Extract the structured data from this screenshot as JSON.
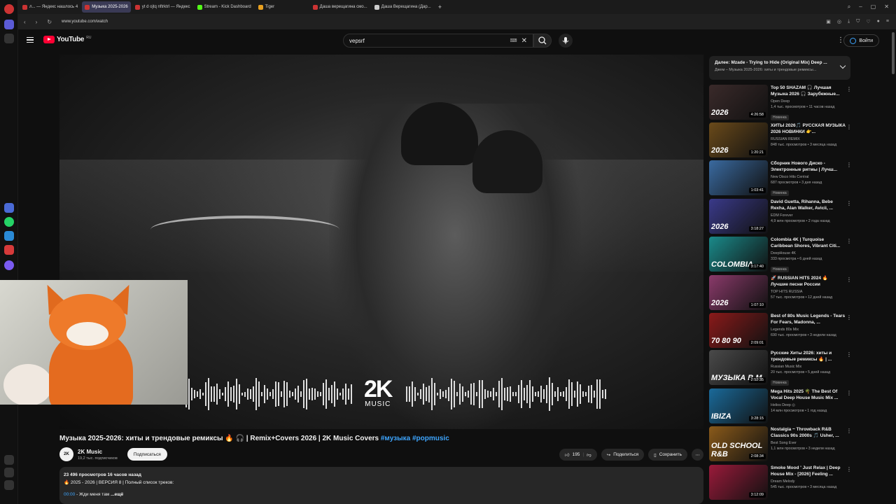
{
  "browser": {
    "tabs": [
      {
        "label": "л... — Яндекс нашлось 4"
      },
      {
        "label": "Музыка 2025-2026",
        "active": true
      },
      {
        "label": "yt d ojtq nftrktrl — Яндекс"
      },
      {
        "label": "Stream - Kick Dashboard"
      },
      {
        "label": "Tiger"
      },
      {
        "label": "Даша верещагина смо..."
      },
      {
        "label": "Даша Верещагина (Дар..."
      }
    ],
    "url": "www.youtube.com/watch"
  },
  "header": {
    "logo_text": "YouTube",
    "logo_region": "RU",
    "search_value": "vepsrf",
    "login_label": "Войти"
  },
  "video": {
    "title_main": "Музыка 2025-2026: хиты и трендовые ремиксы 🔥 🎧 | Remix+Covers 2026 | 2K Music Covers",
    "title_tags": "#музыка #popmusic",
    "logo_big": "2K",
    "logo_small": "MUSIC"
  },
  "channel": {
    "avatar_text": "2K",
    "name": "2K Music",
    "subscribers": "19,2 тыс. подписчиков",
    "subscribe_label": "Подписаться"
  },
  "actions": {
    "likes": "195",
    "share_label": "Поделиться",
    "save_label": "Сохранить"
  },
  "description": {
    "stats": "23 496 просмотров  16 часов назад",
    "line1": "🔥 2025 - 2026 | ВЕРСИЯ 8 | Полный список треков:",
    "timestamp": "00:00",
    "line2": " - Жди меня там",
    "more_label": "...ещё"
  },
  "upnext": {
    "title": "Далее: Mzade - Trying to Hide (Original Mix) Deep ...",
    "subtitle": "Джем – Музыка 2025-2026: хиты и трендовые ремиксы..."
  },
  "recommendations": [
    {
      "title": "Top 50 SHAZAM 🎧 Лучшая Музыка 2026 🎧 Зарубежные...",
      "channel": "Open Deep",
      "meta": "1,4 тыс. просмотров • 11 часов назад",
      "badge": "Новинка",
      "duration": "4:26:58",
      "thumb_text": "2026",
      "color": "#3a2a2a"
    },
    {
      "title": "ХИТЫ 2026🎵 РУССКАЯ МУЗЫКА 2026 НОВИНКИ 👉...",
      "channel": "RUSSIAN REMIX",
      "meta": "848 тыс. просмотров • 3 месяца назад",
      "badge": "",
      "duration": "1:20:21",
      "thumb_text": "2026",
      "color": "#6a4a1a"
    },
    {
      "title": "Сборник Нового Диско - Электронные ритмы | Лучш...",
      "channel": "New Disco Hits Central",
      "meta": "687 просмотров • 3 дня назад",
      "badge": "Новинка",
      "duration": "1:03:41",
      "thumb_text": "",
      "color": "#3a6aa0"
    },
    {
      "title": "David Guetta, Rihanna, Bebe Rexha, Alan Walker, Avicii, ...",
      "channel": "EDM Forever",
      "meta": "4,9 млн просмотров • 2 года назад",
      "badge": "",
      "duration": "3:18:27",
      "thumb_text": "2026",
      "color": "#3a3a8a"
    },
    {
      "title": "Colombia 4K | Turquoise Caribbean Shores, Vibrant Citi...",
      "channel": "DeepHouse 4K",
      "meta": "333 просмотра • 6 дней назад",
      "badge": "Новинка",
      "duration": "3:17:40",
      "thumb_text": "COLOMBIA",
      "color": "#1a8a8a"
    },
    {
      "title": "🚀 RUSSIAN HITS 2024 🔥 Лучшие песни России",
      "channel": "TOP HITS RUSSIA",
      "meta": "57 тыс. просмотров • 12 дней назад",
      "badge": "",
      "duration": "1:07:10",
      "thumb_text": "2026",
      "color": "#8a3a6a"
    },
    {
      "title": "Best of 80s Music Legends - Tears For Fears, Madonna, ...",
      "channel": "Legends 80s Mix",
      "meta": "690 тыс. просмотров • 3 недели назад",
      "badge": "",
      "duration": "2:09:01",
      "thumb_text": "70 80 90",
      "color": "#8a1a1a"
    },
    {
      "title": "Русские Хиты 2026: хиты и трендовые ремиксы 🔥 | ...",
      "channel": "Russian Music Mix",
      "meta": "20 тыс. просмотров • 5 дней назад",
      "badge": "Новинка",
      "duration": "2:52:35",
      "thumb_text": "МУЗЫКА В М",
      "color": "#4a4a4a"
    },
    {
      "title": "Mega Hits 2025 🌴 The Best Of Vocal Deep House Music Mix ...",
      "channel": "Helios Deep ◎",
      "meta": "14 млн просмотров • 1 год назад",
      "badge": "",
      "duration": "3:28:15",
      "thumb_text": "IBIZA",
      "color": "#1a6a9a"
    },
    {
      "title": "Nostalgia ~ Throwback R&B Classics 90s 2000s 🎵 Usher, ...",
      "channel": "Best Song Ever",
      "meta": "1,1 млн просмотров • 3 недели назад",
      "badge": "",
      "duration": "2:08:34",
      "thumb_text": "OLD SCHOOL R&B",
      "color": "#8a5a1a"
    },
    {
      "title": "Smoke Mood ' Just Relax | Deep House Mix - [2026] Feeling ...",
      "channel": "Dream Melody",
      "meta": "545 тыс. просмотров • 3 месяца назад",
      "badge": "",
      "duration": "3:12:09",
      "thumb_text": "",
      "color": "#9a1a3a"
    }
  ]
}
